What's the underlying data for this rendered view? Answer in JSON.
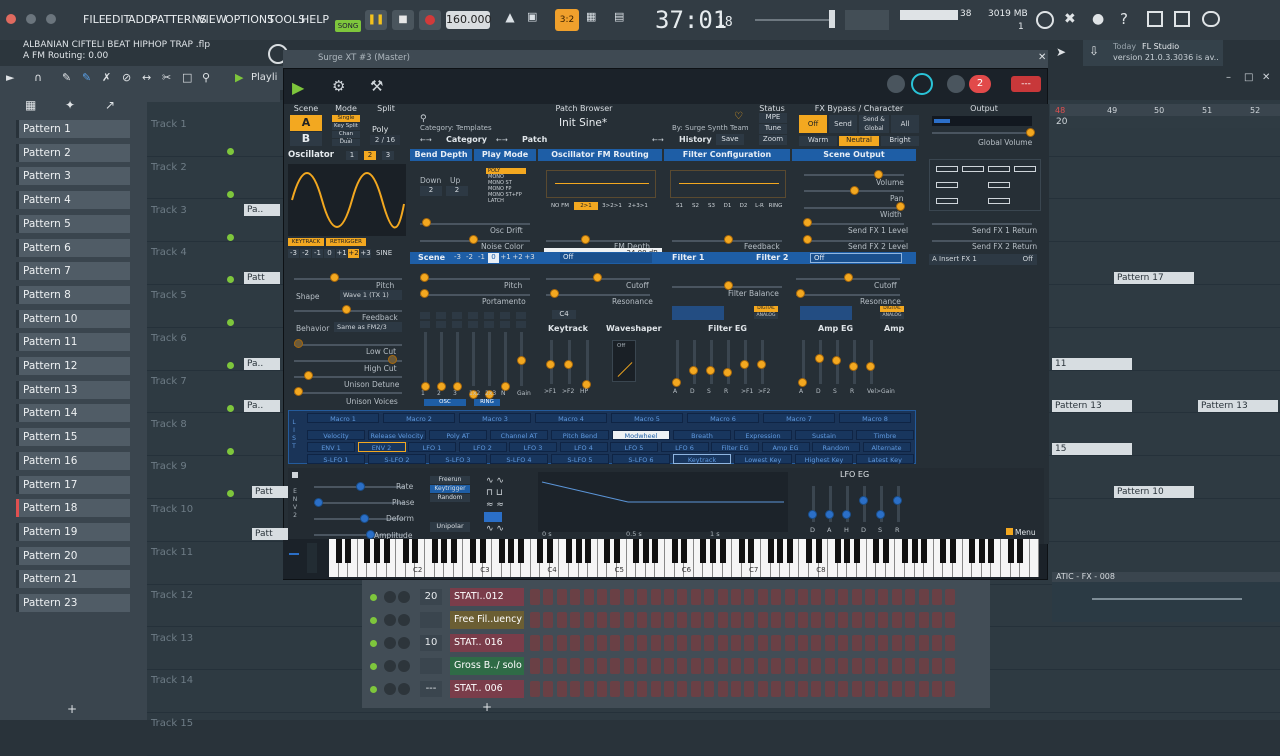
{
  "menu": [
    "FILE",
    "EDIT",
    "ADD",
    "PATTERNS",
    "VIEW",
    "OPTIONS",
    "TOOLS",
    "HELP"
  ],
  "transport": {
    "song": "SONG",
    "tempo": "160.000",
    "time_main": "37:01",
    "time_sub": "18"
  },
  "cpu": {
    "value": "38",
    "ram": "3019 MB",
    "poly": "1"
  },
  "hint": {
    "project": "ALBANIAN CIFTELI BEAT HIPHOP TRAP .flp",
    "info": "A FM Routing: 0.00"
  },
  "news": {
    "label": "Today",
    "app": "FL Studio",
    "version": "version 21.0.3.3036 is av.."
  },
  "playlist_label": "Playli",
  "surge_title": "Surge XT #3 (Master)",
  "patterns": [
    "Pattern 1",
    "Pattern 2",
    "Pattern 3",
    "Pattern 4",
    "Pattern 5",
    "Pattern 6",
    "Pattern 7",
    "Pattern 8",
    "Pattern 10",
    "Pattern 11",
    "Pattern 12",
    "Pattern 13",
    "Pattern 14",
    "Pattern 15",
    "Pattern 16",
    "Pattern 17",
    "Pattern 18",
    "Pattern 19",
    "Pattern 20",
    "Pattern 21",
    "Pattern 23"
  ],
  "tracks": [
    "Track 1",
    "Track 2",
    "Track 3",
    "Track 4",
    "Track 5",
    "Track 6",
    "Track 7",
    "Track 8",
    "Track 9",
    "Track 10",
    "Track 11",
    "Track 12",
    "Track 13",
    "Track 14",
    "Track 15"
  ],
  "clips": [
    "Pa..",
    "Patt",
    "Pa..",
    "Pa..",
    "Pattern 17",
    "11",
    "Pattern 13",
    "Pattern 13",
    "15",
    "Pattern 10",
    "Patt",
    "Patt"
  ],
  "ruler": [
    "48",
    "49",
    "50",
    "51",
    "52"
  ],
  "ruler_left": "20",
  "fx_clip": "ATIC - FX - 008",
  "surge": {
    "scene_h": "Scene",
    "mode_h": "Mode",
    "split_h": "Split",
    "patch_h": "Patch Browser",
    "status_h": "Status",
    "fx_h": "FX Bypass / Character",
    "out_h": "Output",
    "scene_a": "A",
    "scene_b": "B",
    "modes": [
      "Single",
      "Key Split",
      "Chan Split",
      "Dual"
    ],
    "poly": "Poly",
    "poly_val": "2 / 16",
    "category": "Category: Templates",
    "patch": "Init Sine*",
    "author": "By: Surge Synth Team",
    "cat_btn": "Category",
    "patch_btn": "Patch",
    "history": "History",
    "save": "Save",
    "status": [
      "MPE",
      "Tune",
      "Zoom"
    ],
    "fx": [
      "Off",
      "Send",
      "Send & Global",
      "All"
    ],
    "character": [
      "Warm",
      "Neutral",
      "Bright"
    ],
    "global_vol": "Global Volume",
    "osc_h": "Oscillator",
    "osc_nums": [
      "1",
      "2",
      "3"
    ],
    "keytrack": "KEYTRACK",
    "retrigger": "RETRIGGER",
    "octaves": [
      "-3",
      "-2",
      "-1",
      "0",
      "+1",
      "+2",
      "+3"
    ],
    "sine": "SINE",
    "bend": "Bend Depth",
    "playmode": "Play Mode",
    "fmroute": "Oscillator FM Routing",
    "filtercfg": "Filter Configuration",
    "sceneout": "Scene Output",
    "down": "Down",
    "up": "Up",
    "down_v": "2",
    "up_v": "2",
    "playmodes": [
      "POLY",
      "MONO",
      "MONO ST",
      "MONO FP",
      "MONO ST+FP",
      "LATCH"
    ],
    "fm_opts": [
      "NO FM",
      "2>1",
      "3>2>1",
      "2+3>1"
    ],
    "filter_opts": [
      "S1",
      "S2",
      "S3",
      "D1",
      "D2",
      "L-R",
      "RING"
    ],
    "osc_drift": "Osc Drift",
    "noise_color": "Noise Color",
    "fm_depth": "FM Depth",
    "fm_tip": "-24.00 dB",
    "feedback": "Feedback",
    "volume": "Volume",
    "pan": "Pan",
    "width": "Width",
    "sfx1": "Send FX 1 Level",
    "sfx2": "Send FX 2 Level",
    "sfx1r": "Send FX 1 Return",
    "sfx2r": "Send FX 2 Return",
    "scene2": "Scene",
    "scene_oct": [
      "-3",
      "-2",
      "-1",
      "0",
      "+1",
      "+2",
      "+3"
    ],
    "filter1": "Filter 1",
    "filter2": "Filter 2",
    "off": "Off",
    "insert": "A Insert FX 1",
    "insert_v": "Off",
    "pitch": "Pitch",
    "shape": "Shape",
    "wave": "Wave 1 (TX 1)",
    "fb2": "Feedback",
    "behavior": "Behavior",
    "same": "Same as FM2/3",
    "lowcut": "Low Cut",
    "highcut": "High Cut",
    "detune": "Unison Detune",
    "voices": "Unison Voices",
    "pitch2": "Pitch",
    "portamento": "Portamento",
    "cutoff": "Cutoff",
    "resonance": "Resonance",
    "filt_bal": "Filter Balance",
    "cutoff2": "Cutoff",
    "res2": "Resonance",
    "c4": "C4",
    "keytrack2": "Keytrack",
    "waveshaper": "Waveshaper",
    "filter_eg": "Filter EG",
    "amp_eg": "Amp EG",
    "amp": "Amp",
    "digital": "DIGITAL",
    "analog": "ANALOG",
    "mix_labels": [
      "1",
      "2",
      "3",
      "1x2",
      "2x3",
      "N",
      "Gain"
    ],
    "osc": "OSC",
    "ring": "RING",
    "ks_labels": [
      ">F1",
      ">F2",
      "HP"
    ],
    "adsr": [
      "A",
      "D",
      "S",
      "R"
    ],
    "feg_tail": [
      ">F1",
      ">F2"
    ],
    "aeg_tail": [
      "Vel>Gain"
    ],
    "macros": [
      "Macro 1",
      "Macro 2",
      "Macro 3",
      "Macro 4",
      "Macro 5",
      "Macro 6",
      "Macro 7",
      "Macro 8"
    ],
    "mods_row1": [
      "Velocity",
      "Release Velocity",
      "Poly AT",
      "Channel AT",
      "Pitch Bend",
      "Modwheel",
      "Breath",
      "Expression",
      "Sustain",
      "Timbre"
    ],
    "mods_row2": [
      "ENV 1",
      "ENV 2",
      "LFO 1",
      "LFO 2",
      "LFO 3",
      "LFO 4",
      "LFO 5",
      "LFO 6",
      "Filter EG",
      "Amp EG",
      "Random",
      "Alternate"
    ],
    "mods_row3": [
      "S-LFO 1",
      "S-LFO 2",
      "S-LFO 3",
      "S-LFO 4",
      "S-LFO 5",
      "S-LFO 6",
      "Keytrack",
      "Lowest Key",
      "Highest Key",
      "Latest Key"
    ],
    "rate": "Rate",
    "phase": "Phase",
    "deform": "Deform",
    "amplitude": "Amplitude",
    "lfo_mode": [
      "Freerun",
      "Keytrigger",
      "Random"
    ],
    "unipolar": "Unipolar",
    "timeline": [
      "0 s",
      "0.5 s",
      "1 s"
    ],
    "lfo_eg": "LFO EG",
    "lfo_adsr": [
      "D",
      "A",
      "H",
      "D",
      "S",
      "R"
    ],
    "menu": "Menu",
    "keys": [
      "C2",
      "C3",
      "C4",
      "C5",
      "C6",
      "C7",
      "C8"
    ]
  },
  "channels": [
    {
      "num": "20",
      "name": "STATI..012"
    },
    {
      "num": "",
      "name": "Free Fil..uency"
    },
    {
      "num": "10",
      "name": "STAT.. 016"
    },
    {
      "num": "",
      "name": "Gross B../ solo"
    },
    {
      "num": "---",
      "name": "STAT.. 006"
    }
  ],
  "colors": {
    "accent": "#f3a820",
    "blue": "#1e5ea6",
    "green": "#7ec63c"
  }
}
